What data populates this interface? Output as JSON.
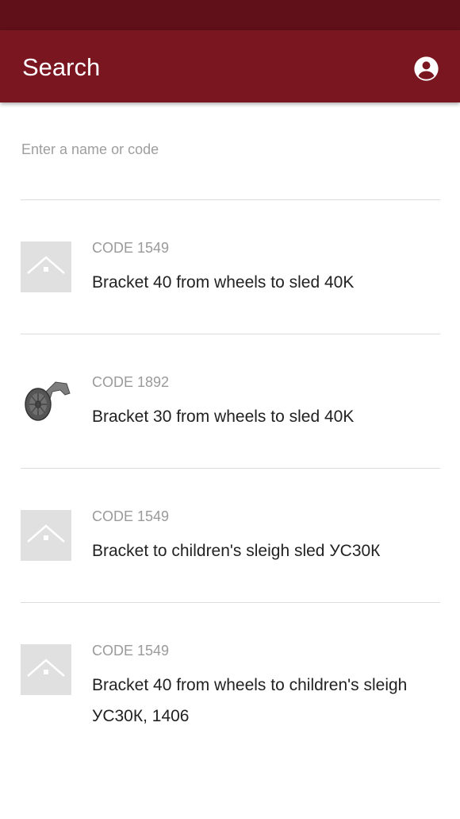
{
  "app_bar": {
    "title": "Search",
    "account_icon": "account-circle-icon"
  },
  "search": {
    "placeholder": "Enter a name or code",
    "value": ""
  },
  "results": [
    {
      "code": "CODE 1549",
      "name": "Bracket 40 from wheels to sled 40K",
      "image": "placeholder-home-icon"
    },
    {
      "code": "CODE 1892",
      "name": "Bracket 30 from wheels to sled 40K",
      "image": "wheel-bracket-photo"
    },
    {
      "code": "CODE 1549",
      "name": "Bracket to children's sleigh sled УС30К",
      "image": "placeholder-home-icon"
    },
    {
      "code": "CODE 1549",
      "name": "Bracket 40 from wheels to children's sleigh УС30К, 1406",
      "image": "placeholder-home-icon"
    }
  ],
  "colors": {
    "status_bar": "#5f1018",
    "app_bar": "#7a1620",
    "divider": "#dcdcdc",
    "code_text": "#9a9a9a"
  }
}
